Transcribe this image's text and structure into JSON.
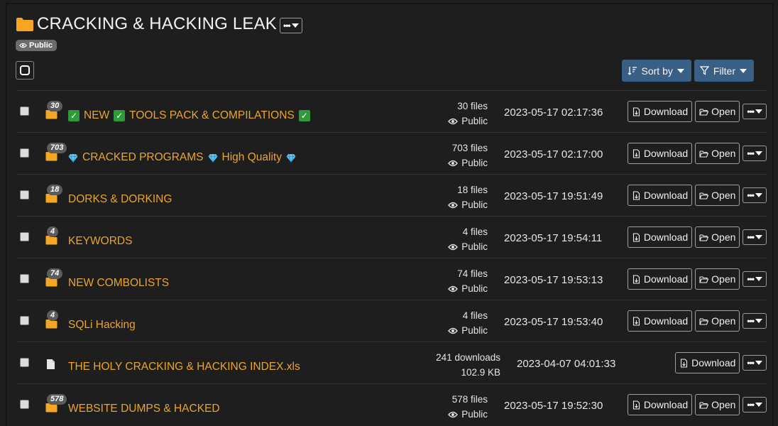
{
  "header": {
    "title": "CRACKING & HACKING LEAK",
    "visibility": "Public"
  },
  "toolbar": {
    "sort_label": "Sort by",
    "filter_label": "Filter"
  },
  "actions": {
    "download_label": "Download",
    "open_label": "Open"
  },
  "colors": {
    "folder": "#f5a623",
    "link": "#e8a530",
    "toolbar_button": "#3a5f85",
    "background": "#1e1e1e"
  },
  "rows": [
    {
      "type": "folder",
      "count": "30",
      "name_parts": [
        "NEW",
        "TOOLS PACK & COMPILATIONS"
      ],
      "icons": "check-emoji",
      "meta1": "30 files",
      "meta2": "Public",
      "date": "2023-05-17 02:17:36"
    },
    {
      "type": "folder",
      "count": "703",
      "name_parts": [
        "CRACKED PROGRAMS",
        "High Quality"
      ],
      "icons": "gem-emoji",
      "meta1": "703 files",
      "meta2": "Public",
      "date": "2023-05-17 02:17:00"
    },
    {
      "type": "folder",
      "count": "18",
      "name": "DORKS & DORKING",
      "meta1": "18 files",
      "meta2": "Public",
      "date": "2023-05-17 19:51:49"
    },
    {
      "type": "folder",
      "count": "4",
      "name": "KEYWORDS",
      "meta1": "4 files",
      "meta2": "Public",
      "date": "2023-05-17 19:54:11"
    },
    {
      "type": "folder",
      "count": "74",
      "name": "NEW COMBOLISTS",
      "meta1": "74 files",
      "meta2": "Public",
      "date": "2023-05-17 19:53:13"
    },
    {
      "type": "folder",
      "count": "4",
      "name": "SQLi Hacking",
      "meta1": "4 files",
      "meta2": "Public",
      "date": "2023-05-17 19:53:40"
    },
    {
      "type": "file",
      "name": "THE HOLY CRACKING & HACKING INDEX.xls",
      "meta1": "241 downloads",
      "meta2": "102.9 KB",
      "date": "2023-04-07 04:01:33"
    },
    {
      "type": "folder",
      "count": "578",
      "name": "WEBSITE DUMPS & HACKED",
      "meta1": "578 files",
      "meta2": "Public",
      "date": "2023-05-17 19:52:30"
    }
  ]
}
